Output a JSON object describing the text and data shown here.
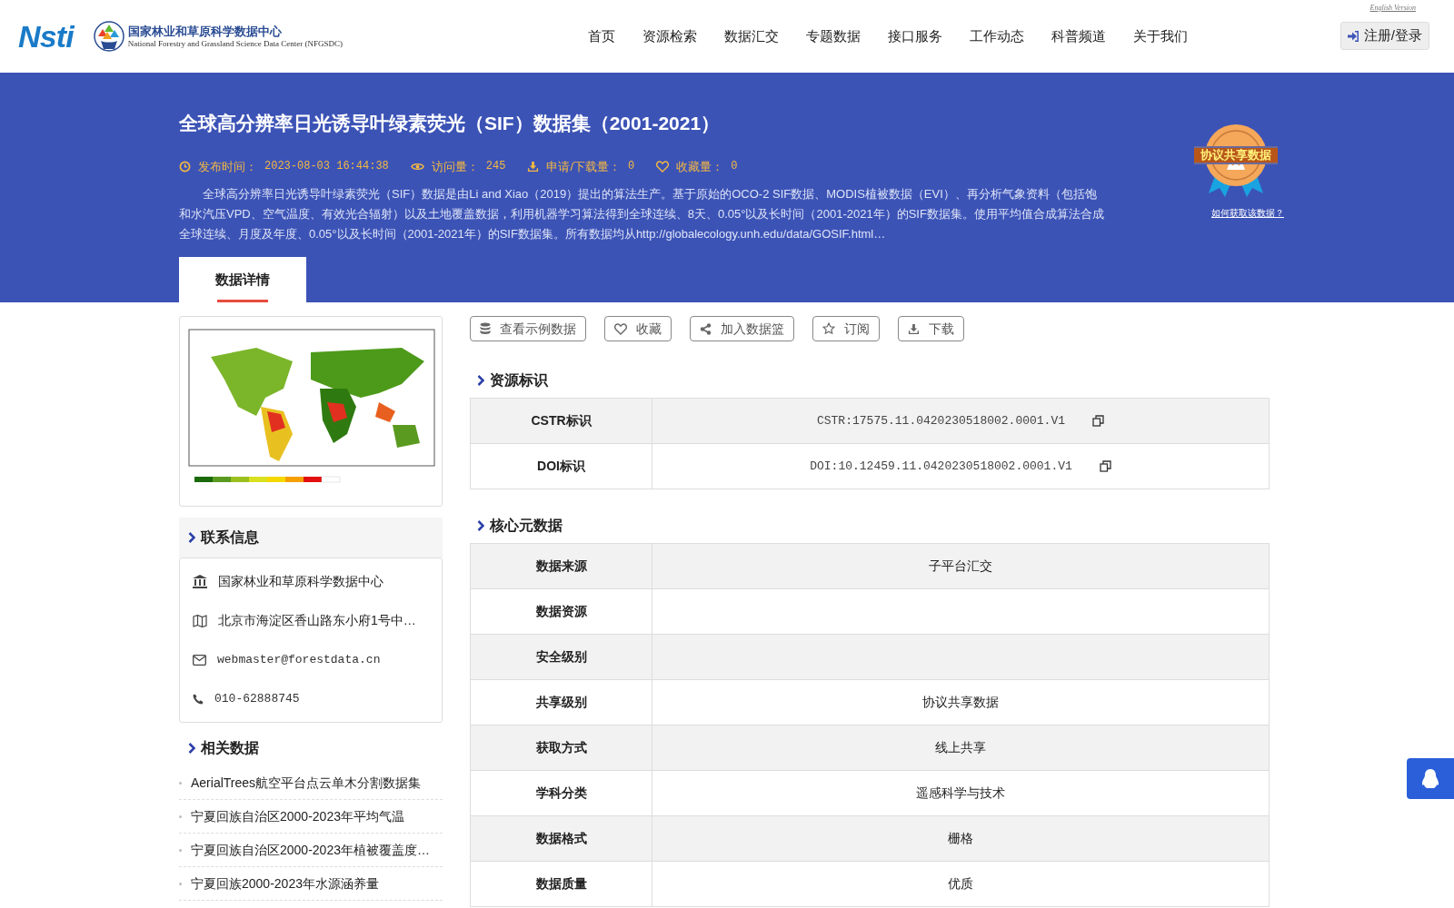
{
  "header": {
    "logo_text": "Nsti",
    "org_name": "国家林业和草原科学数据中心",
    "org_name_en": "National Forestry and Grassland Science Data Center (NFGSDC)",
    "nav": [
      "首页",
      "资源检索",
      "数据汇交",
      "专题数据",
      "接口服务",
      "工作动态",
      "科普频道",
      "关于我们"
    ],
    "english_link": "English Version",
    "login_button": "注册/登录"
  },
  "banner": {
    "title": "全球高分辨率日光诱导叶绿素荧光（SIF）数据集（2001-2021）",
    "meta": [
      {
        "kind": "time",
        "label": "发布时间：",
        "value": "2023-08-03 16:44:38"
      },
      {
        "kind": "views",
        "label": "访问量：",
        "value": "245"
      },
      {
        "kind": "download",
        "label": "申请/下载量：",
        "value": "0"
      },
      {
        "kind": "favorite",
        "label": "收藏量：",
        "value": "0"
      }
    ],
    "description": "全球高分辨率日光诱导叶绿素荧光（SIF）数据是由Li and Xiao（2019）提出的算法生产。基于原始的OCO-2 SIF数据、MODIS植被数据（EVI）、再分析气象资料（包括饱和水汽压VPD、空气温度、有效光合辐射）以及土地覆盖数据，利用机器学习算法得到全球连续、8天、0.05°以及长时间（2001-2021年）的SIF数据集。使用平均值合成算法合成全球连续、月度及年度、0.05°以及长时间（2001-2021年）的SIF数据集。所有数据均从http://globalecology.unh.edu/data/GOSIF.html…",
    "badge": {
      "text": "协议共享数据",
      "link": "如何获取该数据？"
    },
    "tabs": [
      {
        "label": "数据详情",
        "selected": true
      }
    ]
  },
  "sidebar": {
    "contact": {
      "title": "联系信息",
      "items": [
        {
          "kind": "org",
          "text": "国家林业和草原科学数据中心"
        },
        {
          "kind": "address",
          "text": "北京市海淀区香山路东小府1号中…"
        },
        {
          "kind": "email",
          "text": "webmaster@forestdata.cn"
        },
        {
          "kind": "phone",
          "text": "010-62888745"
        }
      ]
    },
    "related": {
      "title": "相关数据",
      "items": [
        "AerialTrees航空平台点云单木分割数据集",
        "宁夏回族自治区2000-2023年平均气温",
        "宁夏回族自治区2000-2023年植被覆盖度…",
        "宁夏回族2000-2023年水源涵养量"
      ]
    }
  },
  "actions": [
    {
      "kind": "database",
      "label": "查看示例数据"
    },
    {
      "kind": "heart",
      "label": "收藏"
    },
    {
      "kind": "share",
      "label": "加入数据篮"
    },
    {
      "kind": "star",
      "label": "订阅"
    },
    {
      "kind": "download",
      "label": "下载"
    }
  ],
  "sections": [
    {
      "title": "资源标识",
      "rows": [
        {
          "label": "CSTR标识",
          "value": "CSTR:17575.11.0420230518002.0001.V1",
          "copy": true
        },
        {
          "label": "DOI标识",
          "value": "DOI:10.12459.11.0420230518002.0001.V1",
          "copy": true
        }
      ]
    },
    {
      "title": "核心元数据",
      "rows": [
        {
          "label": "数据来源",
          "value": "子平台汇交",
          "copy": false
        },
        {
          "label": "数据资源",
          "copy": false
        },
        {
          "label": "安全级别",
          "copy": false
        },
        {
          "label": "共享级别",
          "value": "协议共享数据",
          "copy": false
        },
        {
          "label": "获取方式",
          "value": "线上共享",
          "copy": false
        },
        {
          "label": "学科分类",
          "value": "遥感科学与技术",
          "copy": false
        },
        {
          "label": "数据格式",
          "value": "栅格",
          "copy": false
        },
        {
          "label": "数据质量",
          "value": "优质",
          "copy": false
        }
      ]
    }
  ]
}
